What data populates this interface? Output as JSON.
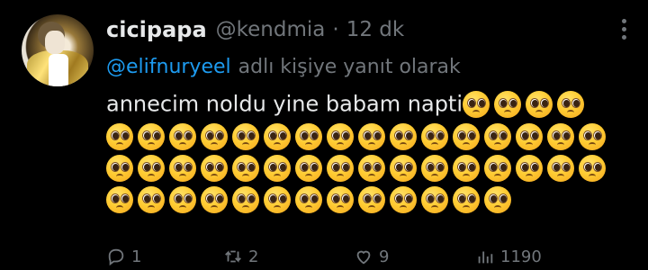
{
  "tweet": {
    "display_name": "cicipapa",
    "handle": "@kendmia",
    "separator": "·",
    "time": "12 dk",
    "reply": {
      "mention": "@elifnuryeel",
      "rest": "adlı kişiye yanıt olarak"
    },
    "text": "annecim noldu yine babam napti",
    "emoji_name": "pleading-face-emoji",
    "emoji_count": 49
  },
  "actions": [
    {
      "name": "reply",
      "icon": "reply-icon",
      "count": "1"
    },
    {
      "name": "retweet",
      "icon": "retweet-icon",
      "count": "2"
    },
    {
      "name": "like",
      "icon": "heart-icon",
      "count": "9"
    },
    {
      "name": "views",
      "icon": "views-icon",
      "count": "1190"
    }
  ],
  "colors": {
    "background": "#000000",
    "text": "#e7e9ea",
    "secondary": "#71767b",
    "link": "#1d9bf0"
  }
}
